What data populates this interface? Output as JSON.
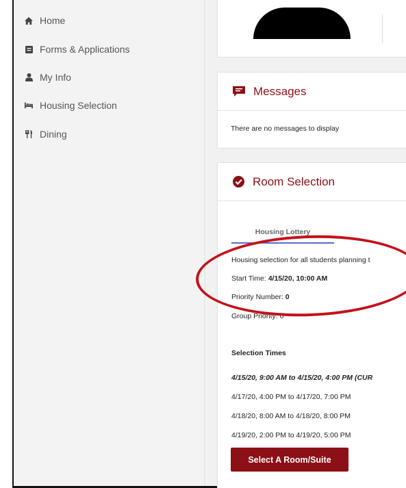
{
  "sidebar": {
    "items": [
      {
        "label": "Home",
        "icon": "home-icon",
        "has_chevron": false
      },
      {
        "label": "Forms & Applications",
        "icon": "form-icon",
        "has_chevron": true
      },
      {
        "label": "My Info",
        "icon": "user-icon",
        "has_chevron": true
      },
      {
        "label": "Housing Selection",
        "icon": "bed-icon",
        "has_chevron": true
      },
      {
        "label": "Dining",
        "icon": "utensils-icon",
        "has_chevron": true
      }
    ]
  },
  "messages": {
    "title": "Messages",
    "body": "There are no messages to display"
  },
  "room_selection": {
    "title": "Room Selection",
    "tab_label": "Housing Lottery",
    "intro": "Housing selection for all students planning t",
    "start_time_label": "Start Time:",
    "start_time_value": "4/15/20, 10:00 AM",
    "priority_label": "Priority Number:",
    "priority_value": "0",
    "group_priority": "Group Priority: 0",
    "selection_times_heading": "Selection Times",
    "selection_times": [
      "4/15/20, 9:00 AM to 4/15/20, 4:00 PM (CUR",
      "4/17/20, 4:00 PM to 4/17/20, 7:00 PM",
      "4/18/20, 8:00 AM to 4/18/20, 8:00 PM",
      "4/19/20, 2:00 PM to 4/19/20, 5:00 PM"
    ],
    "button_label": "Select A Room/Suite"
  },
  "colors": {
    "accent": "#8c1016",
    "annotation": "#c4111b",
    "tab_underline": "#5570c7"
  }
}
